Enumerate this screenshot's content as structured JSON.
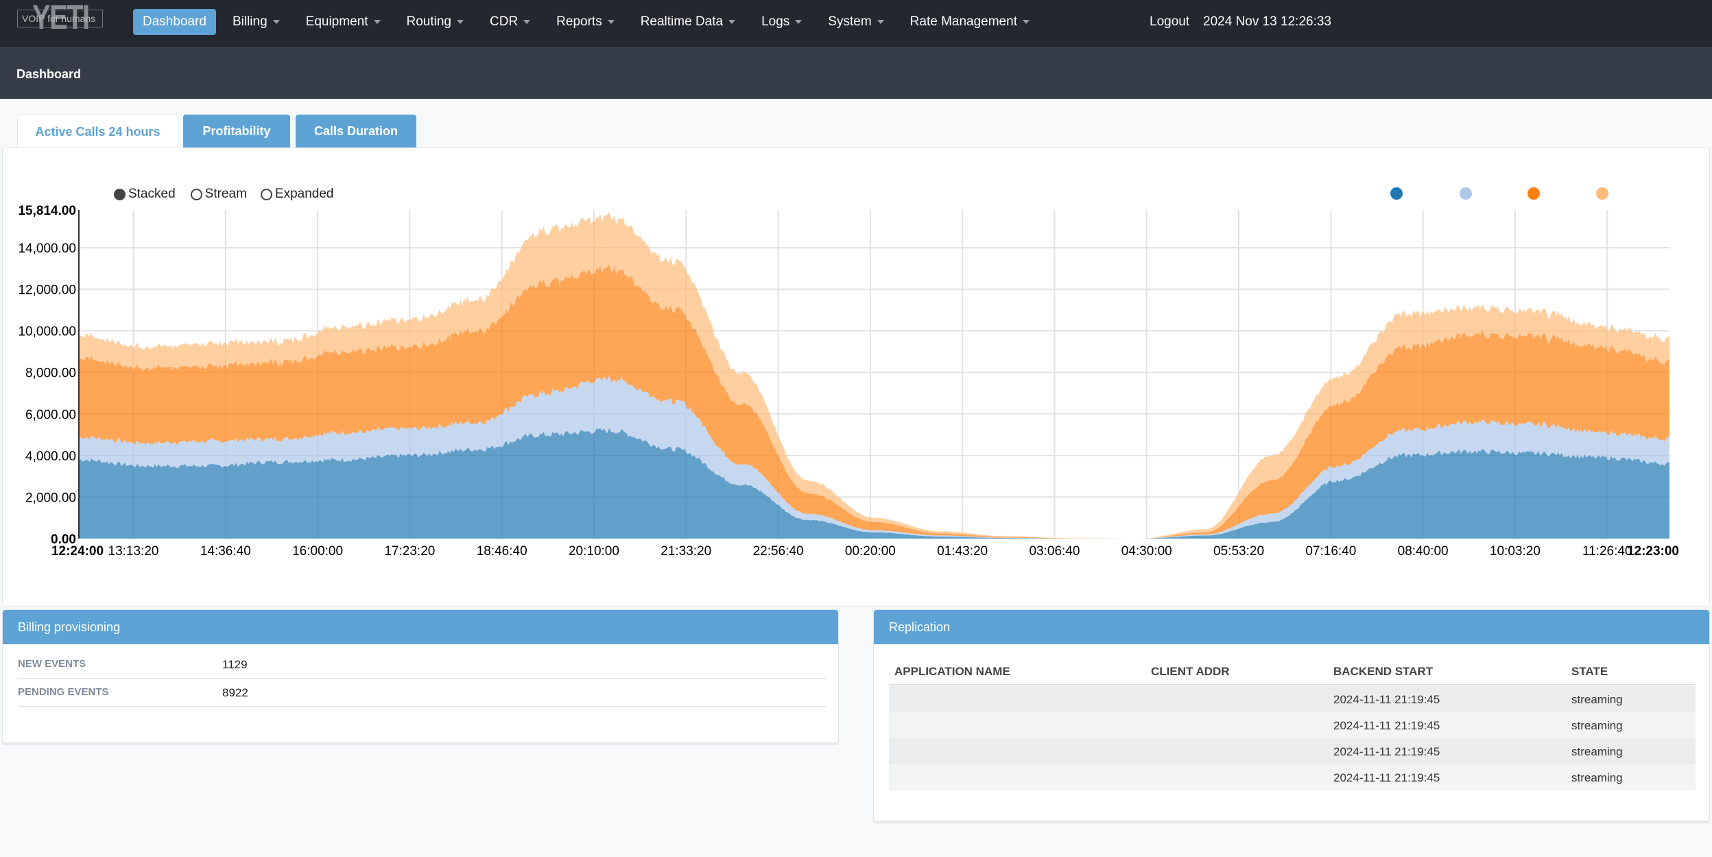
{
  "logo": {
    "big": "YETI",
    "tagline": "VOIP for humans"
  },
  "nav": {
    "items": [
      {
        "label": "Dashboard",
        "active": true,
        "dropdown": false
      },
      {
        "label": "Billing",
        "dropdown": true
      },
      {
        "label": "Equipment",
        "dropdown": true
      },
      {
        "label": "Routing",
        "dropdown": true
      },
      {
        "label": "CDR",
        "dropdown": true
      },
      {
        "label": "Reports",
        "dropdown": true
      },
      {
        "label": "Realtime Data",
        "dropdown": true
      },
      {
        "label": "Logs",
        "dropdown": true
      },
      {
        "label": "System",
        "dropdown": true
      },
      {
        "label": "Rate Management",
        "dropdown": true
      }
    ],
    "logout": "Logout",
    "datetime": "2024 Nov 13 12:26:33"
  },
  "page": {
    "title": "Dashboard"
  },
  "tabs": [
    {
      "label": "Active Calls 24 hours",
      "active": true
    },
    {
      "label": "Profitability"
    },
    {
      "label": "Calls Duration"
    }
  ],
  "chart_controls": {
    "options": [
      "Stacked",
      "Stream",
      "Expanded"
    ],
    "selected": "Stacked"
  },
  "chart_data": {
    "type": "area",
    "stacked": true,
    "colors": [
      "#1f77b4",
      "#aec7e8",
      "#ff7f0e",
      "#ffbb78"
    ],
    "x": [
      "12:24",
      "13:24",
      "14:24",
      "15:24",
      "16:24",
      "17:24",
      "18:24",
      "19:24",
      "20:24",
      "21:24",
      "22:24",
      "23:24",
      "00:24",
      "01:24",
      "02:24",
      "03:24",
      "04:24",
      "05:24",
      "06:24",
      "07:24",
      "08:24",
      "09:24",
      "10:24",
      "11:24",
      "12:23"
    ],
    "series": [
      {
        "values": [
          3800,
          3500,
          3500,
          3700,
          3800,
          4000,
          4300,
          5000,
          5200,
          4300,
          2600,
          900,
          300,
          100,
          30,
          0,
          0,
          150,
          800,
          2800,
          4000,
          4200,
          4100,
          3900,
          3600
        ]
      },
      {
        "values": [
          1100,
          1100,
          1200,
          1100,
          1300,
          1300,
          1300,
          2000,
          2500,
          2300,
          1000,
          300,
          100,
          50,
          10,
          0,
          0,
          50,
          400,
          700,
          1200,
          1400,
          1400,
          1200,
          1200
        ]
      },
      {
        "values": [
          3800,
          3600,
          3600,
          3700,
          3900,
          3900,
          4400,
          5300,
          5300,
          4400,
          2900,
          1000,
          400,
          100,
          40,
          10,
          0,
          100,
          1600,
          3000,
          4000,
          4200,
          4200,
          4100,
          3700
        ]
      },
      {
        "values": [
          1100,
          1000,
          1100,
          1000,
          1200,
          1300,
          1500,
          2500,
          2500,
          2300,
          1500,
          600,
          200,
          100,
          40,
          10,
          0,
          150,
          1200,
          1300,
          1600,
          1300,
          1200,
          1000,
          1100
        ]
      }
    ],
    "ylim": [
      0,
      15814
    ],
    "y_ticks": [
      "0.00",
      "2,000.00",
      "4,000.00",
      "6,000.00",
      "8,000.00",
      "10,000.00",
      "12,000.00",
      "14,000.00",
      "15,814.00"
    ],
    "y_tick_values": [
      0,
      2000,
      4000,
      6000,
      8000,
      10000,
      12000,
      14000,
      15814
    ],
    "x_ticks": [
      "12:24:00",
      "13:13:20",
      "14:36:40",
      "16:00:00",
      "17:23:20",
      "18:46:40",
      "20:10:00",
      "21:33:20",
      "22:56:40",
      "00:20:00",
      "01:43:20",
      "03:06:40",
      "04:30:00",
      "05:53:20",
      "07:16:40",
      "08:40:00",
      "10:03:20",
      "11:26:40",
      "12:23:00"
    ],
    "x_tick_minutes": [
      0,
      49.33,
      132.67,
      216,
      299.33,
      382.67,
      466,
      549.33,
      632.67,
      716,
      799.33,
      882.67,
      966,
      1049.33,
      1132.67,
      1216,
      1299.33,
      1382.67,
      1439
    ],
    "grid": true,
    "legend": "top-right"
  },
  "billing": {
    "title": "Billing provisioning",
    "rows": [
      {
        "label": "NEW EVENTS",
        "value": "1129"
      },
      {
        "label": "PENDING EVENTS",
        "value": "8922"
      }
    ]
  },
  "replication": {
    "title": "Replication",
    "columns": [
      "APPLICATION NAME",
      "CLIENT ADDR",
      "BACKEND START",
      "STATE"
    ],
    "rows": [
      {
        "app": "",
        "addr": "",
        "start": "2024-11-11 21:19:45",
        "state": "streaming"
      },
      {
        "app": "",
        "addr": "",
        "start": "2024-11-11 21:19:45",
        "state": "streaming"
      },
      {
        "app": "",
        "addr": "",
        "start": "2024-11-11 21:19:45",
        "state": "streaming"
      },
      {
        "app": "",
        "addr": "",
        "start": "2024-11-11 21:19:45",
        "state": "streaming"
      }
    ]
  }
}
